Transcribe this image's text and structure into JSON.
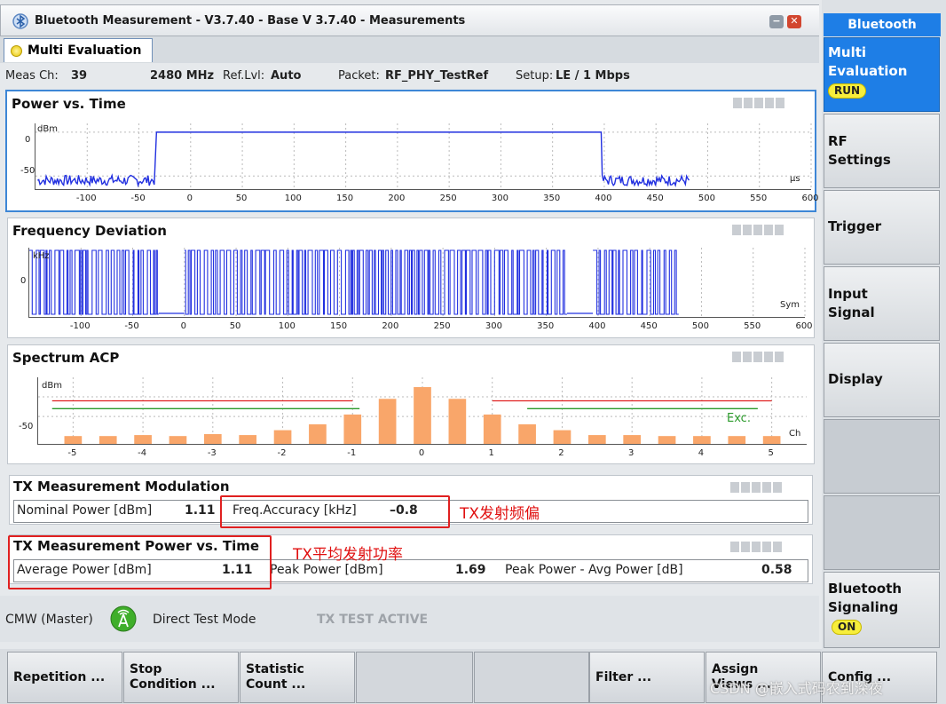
{
  "window": {
    "title": "Bluetooth Measurement  - V3.7.40 - Base V 3.7.40 - Measurements",
    "tab_label": "Multi Evaluation"
  },
  "infobar": {
    "meas_ch_label": "Meas Ch:",
    "meas_ch_value": "39",
    "freq": "2480 MHz",
    "ref_lvl_label": "Ref.Lvl:",
    "ref_lvl_value": "Auto",
    "packet_label": "Packet:",
    "packet_value": "RF_PHY_TestRef",
    "setup_label": "Setup:",
    "setup_value": "LE / 1 Mbps"
  },
  "power_vs_time": {
    "title": "Power vs. Time",
    "y_unit": "dBm",
    "y_ticks": [
      "0",
      "-50"
    ],
    "x_unit": "µs",
    "x_ticks": [
      "-100",
      "-50",
      "0",
      "50",
      "100",
      "150",
      "200",
      "250",
      "300",
      "350",
      "400",
      "450",
      "500",
      "550",
      "600"
    ],
    "chart_data": {
      "type": "line",
      "xlim": [
        -150,
        600
      ],
      "ylim": [
        -65,
        10
      ],
      "burst_level_dbm": 0,
      "noise_floor_dbm": -55,
      "burst_start_us": -33,
      "burst_end_us": 397,
      "trace_end_us": 482,
      "color": "#2230e0"
    }
  },
  "freq_dev": {
    "title": "Frequency Deviation",
    "y_unit": "kHz",
    "y_ticks": [
      "0"
    ],
    "x_unit": "Sym",
    "x_ticks": [
      "-100",
      "-50",
      "0",
      "50",
      "100",
      "150",
      "200",
      "250",
      "300",
      "350",
      "400",
      "450",
      "500",
      "550",
      "600"
    ],
    "chart_data": {
      "type": "line",
      "xlim": [
        -150,
        600
      ],
      "segments_sym": [
        [
          -150,
          -25
        ],
        [
          0,
          370
        ],
        [
          395,
          478
        ]
      ],
      "color": "#2230e0"
    }
  },
  "spectrum_acp": {
    "title": "Spectrum ACP",
    "y_unit": "dBm",
    "y_ticks": [
      "-50"
    ],
    "x_unit": "Ch",
    "limit_label": "Exc.",
    "chart_data": {
      "type": "bar",
      "categories": [
        "-5",
        "-4.5",
        "-4",
        "-3.5",
        "-3",
        "-2.5",
        "-2",
        "-1.5",
        "-1",
        "-0.5",
        "0",
        "0.5",
        "1",
        "1.5",
        "2",
        "2.5",
        "3",
        "3.5",
        "4",
        "4.5",
        "5"
      ],
      "x_ticks": [
        "-5",
        "-4",
        "-3",
        "-2",
        "-1",
        "0",
        "1",
        "2",
        "3",
        "4",
        "5"
      ],
      "values": [
        -60,
        -60,
        -59.5,
        -60,
        -59,
        -59.5,
        -57,
        -54,
        -49,
        -41,
        -35,
        -41,
        -49,
        -54,
        -57,
        -59.5,
        -59.5,
        -60,
        -60,
        -60,
        -60
      ],
      "ylim": [
        -64,
        -30
      ],
      "bar_color": "#f9a66a",
      "limit_red": {
        "value": -42,
        "ranges": [
          [
            -5.3,
            -1.0
          ],
          [
            1.0,
            5.0
          ]
        ],
        "color": "#e02020"
      },
      "limit_green": {
        "value": -46,
        "ranges": [
          [
            -5.3,
            -0.9
          ],
          [
            1.5,
            4.8
          ]
        ],
        "color": "#2a9a2a"
      }
    }
  },
  "tx_modulation": {
    "title": "TX Measurement Modulation",
    "nominal_power_label": "Nominal Power [dBm]",
    "nominal_power_value": "1.11",
    "freq_accuracy_label": "Freq.Accuracy [kHz]",
    "freq_accuracy_value": "–0.8",
    "annotation": "TX发射频偏"
  },
  "tx_power": {
    "title": "TX Measurement Power vs. Time",
    "average_power_label": "Average Power [dBm]",
    "average_power_value": "1.11",
    "peak_power_label": "Peak Power [dBm]",
    "peak_power_value": "1.69",
    "peak_avg_label": "Peak Power - Avg Power [dB]",
    "peak_avg_value": "0.58",
    "annotation": "TX平均发射功率"
  },
  "status": {
    "instrument": "CMW (Master)",
    "mode": "Direct Test Mode",
    "state": "TX TEST ACTIVE"
  },
  "softkeys": {
    "repetition": "Repetition ...",
    "stop_condition": "Stop Condition ...",
    "statistic_count": "Statistic Count ...",
    "filter": "Filter ...",
    "assign_views": "Assign Views ...",
    "config": "Config ..."
  },
  "side_menu": {
    "header": "Bluetooth",
    "multi_evaluation": "Multi Evaluation",
    "run_badge": "RUN",
    "rf_settings": "RF Settings",
    "trigger": "Trigger",
    "input_signal": "Input Signal",
    "display": "Display",
    "bt_signaling": "Bluetooth Signaling",
    "on_badge": "ON"
  },
  "watermark": "CSDN @嵌入式码农到深夜"
}
